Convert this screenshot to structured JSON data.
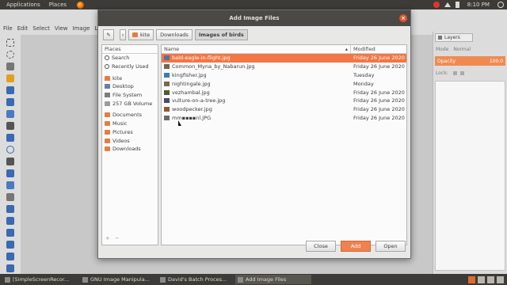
{
  "top_panel": {
    "menu": [
      "Applications",
      "Places"
    ],
    "time": "8:10 PM"
  },
  "gimp": {
    "menu": [
      "File",
      "Edit",
      "Select",
      "View",
      "Image",
      "Lay"
    ],
    "layers_tab": "Layers",
    "mode_label": "Mode",
    "mode_value": "Normal",
    "opacity_label": "Opacity",
    "opacity_value": "100.0",
    "lock_label": "Lock:"
  },
  "dialog": {
    "title": "Add Image Files",
    "path": [
      "kite",
      "Downloads",
      "Images of birds"
    ],
    "places_header": "Places",
    "places": [
      {
        "icon": "search",
        "label": "Search"
      },
      {
        "icon": "clock",
        "label": "Recently Used"
      },
      {
        "icon": "home",
        "label": "kite",
        "gap_before": true
      },
      {
        "icon": "desk",
        "label": "Desktop"
      },
      {
        "icon": "fs",
        "label": "File System"
      },
      {
        "icon": "vol",
        "label": "257 GB Volume"
      },
      {
        "icon": "folder",
        "label": "Documents",
        "gap_before": true
      },
      {
        "icon": "folder",
        "label": "Music"
      },
      {
        "icon": "folder",
        "label": "Pictures"
      },
      {
        "icon": "folder",
        "label": "Videos"
      },
      {
        "icon": "folder",
        "label": "Downloads"
      }
    ],
    "places_footer": [
      "+",
      "−"
    ],
    "columns": {
      "name": "Name",
      "modified": "Modified"
    },
    "files": [
      {
        "name": "bald-eagle-in-flight.jpg",
        "modified": "Friday 26 June 2020",
        "selected": true,
        "color": "#5a6e99"
      },
      {
        "name": "Common_Myna_by_Nabarun.jpg",
        "modified": "Friday 26 June 2020",
        "color": "#6d6a4e"
      },
      {
        "name": "kingfisher.jpg",
        "modified": "Tuesday",
        "color": "#3a7bb0"
      },
      {
        "name": "nightingale.jpg",
        "modified": "Monday",
        "color": "#7a6a4a"
      },
      {
        "name": "vezhambal.jpg",
        "modified": "Friday 26 June 2020",
        "color": "#4b5a3a"
      },
      {
        "name": "vulture-on-a-tree.jpg",
        "modified": "Friday 26 June 2020",
        "color": "#4a4a6a"
      },
      {
        "name": "woodpecker.jpg",
        "modified": "Friday 26 June 2020",
        "color": "#8a5a3a"
      },
      {
        "name": "mm▪▪▪▪nl.JPG",
        "modified": "Friday 26 June 2020",
        "color": "#6a6a6a"
      }
    ],
    "buttons": {
      "close": "Close",
      "add": "Add",
      "open": "Open"
    }
  },
  "taskbar": [
    {
      "label": "[SimpleScreenRecor...",
      "active": false
    },
    {
      "label": "GNU Image Manipula...",
      "active": false
    },
    {
      "label": "David's Batch Proces...",
      "active": false
    },
    {
      "label": "Add Image Files",
      "active": true
    }
  ]
}
